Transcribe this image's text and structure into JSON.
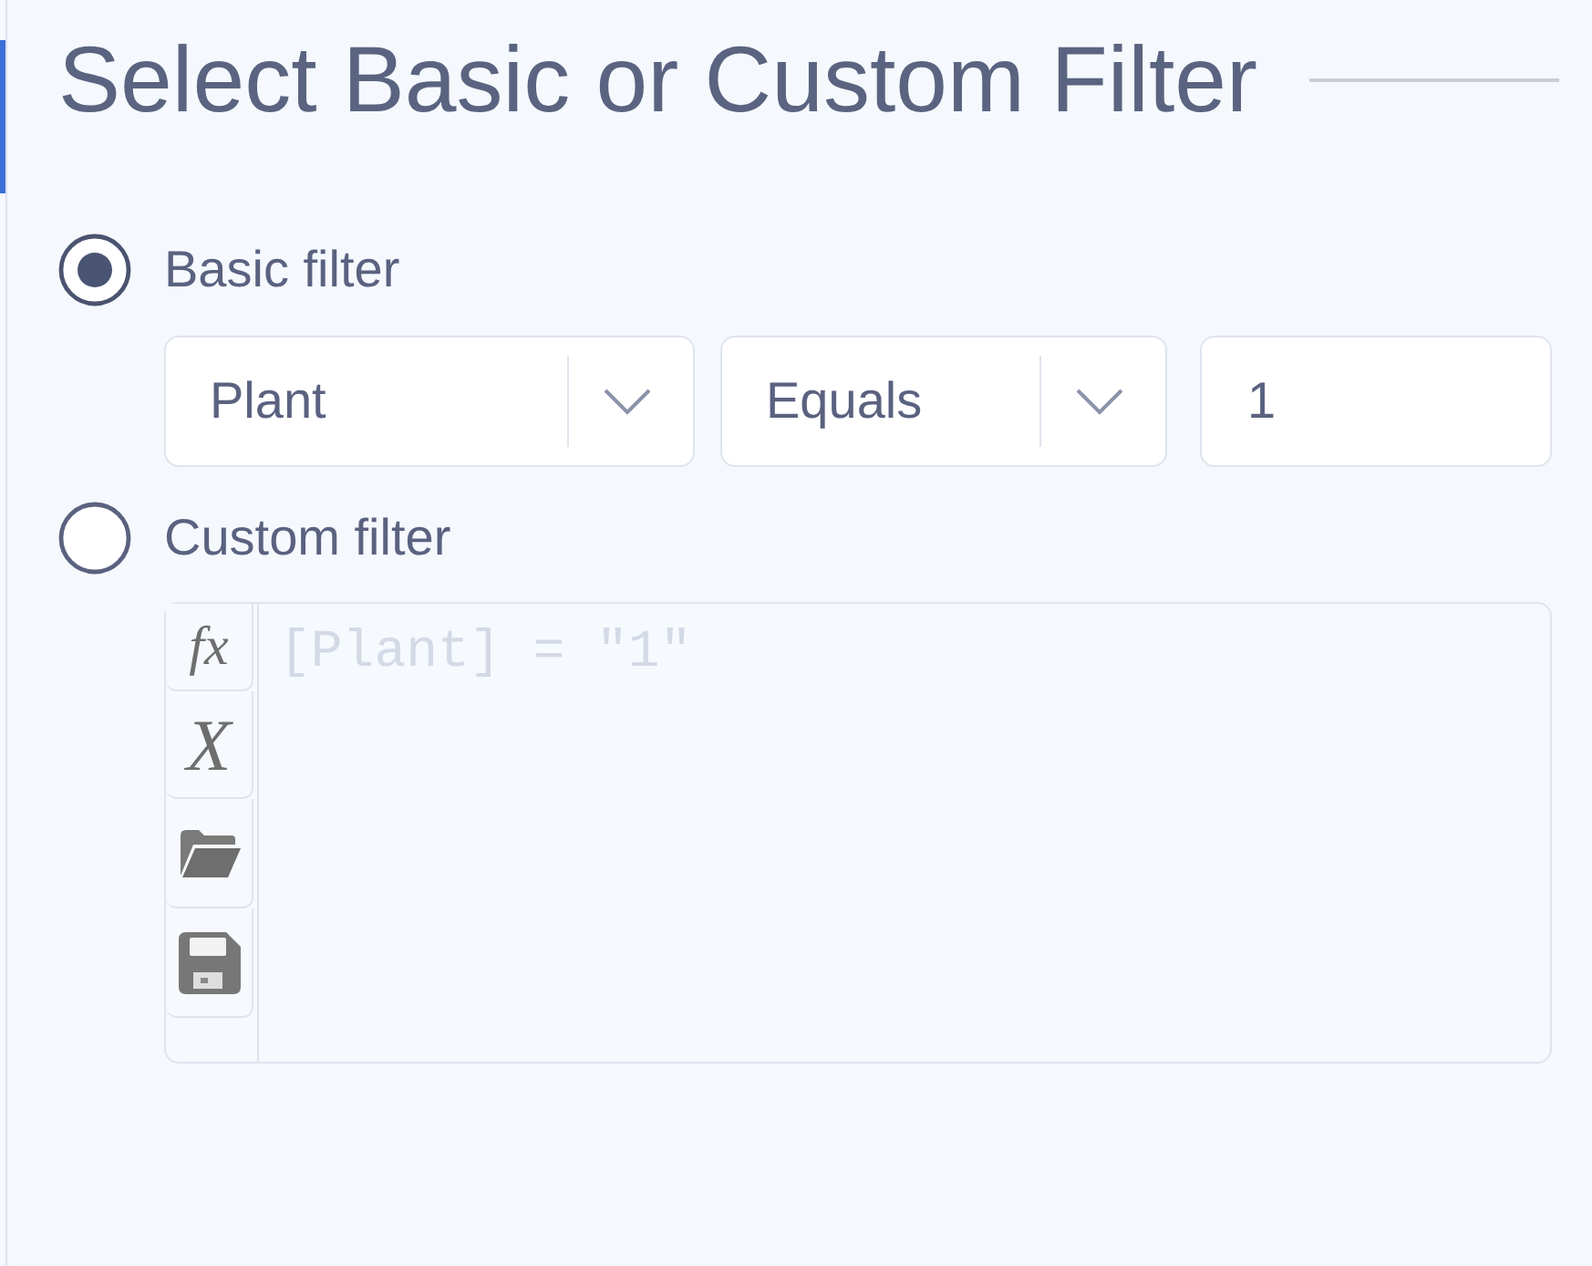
{
  "title": "Select Basic or Custom Filter",
  "options": [
    {
      "label": "Basic filter",
      "selected": true
    },
    {
      "label": "Custom filter",
      "selected": false
    }
  ],
  "basic_filter": {
    "column_select": {
      "value": "Plant"
    },
    "operator_select": {
      "value": "Equals"
    },
    "value_field": {
      "value": "1"
    }
  },
  "custom_filter": {
    "toolbar": [
      {
        "kind": "function",
        "glyph": "fx"
      },
      {
        "kind": "variable",
        "glyph": "X"
      },
      {
        "kind": "folder"
      },
      {
        "kind": "save"
      }
    ],
    "editor": {
      "placeholder": "[Plant] = \"1\""
    }
  }
}
